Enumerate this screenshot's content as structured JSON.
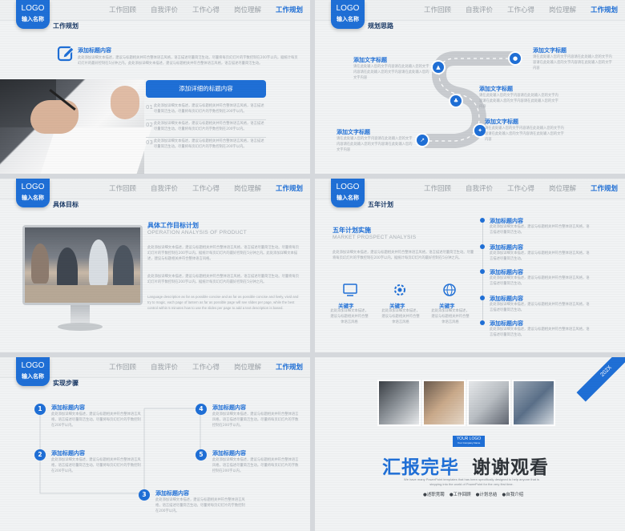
{
  "nav": [
    "工作回顾",
    "自我评价",
    "工作心得",
    "岗位理解",
    "工作规划"
  ],
  "logo": {
    "line1": "LOGO",
    "line2": "输入名称"
  },
  "slide1": {
    "title": "工作规划",
    "heading": "添加标题内容",
    "body": "此处添加详细文本描述，建议与标题相关并符合整体语言风格，语言描述尽量简洁生动。尽量将每页幻灯片的字数控制在200字以内，据统计每页幻灯片的最好控制在5分钟之内。此处添加详细文本描述，建议与标题相关并符合整体语言风格，语言描述尽量简洁生动。",
    "button": "添加详细的标题内容",
    "items": [
      {
        "n": "01",
        "t": "此处添加详细文本描述，建议与标题相关并符合整体语言风格，语言描述尽量简洁生动。尽量将每页幻灯片的字数控制在200字以内。"
      },
      {
        "n": "02",
        "t": "此处添加详细文本描述，建议与标题相关并符合整体语言风格，语言描述尽量简洁生动。尽量将每页幻灯片的字数控制在200字以内。"
      },
      {
        "n": "03",
        "t": "此处添加详细文本描述，建议与标题相关并符合整体语言风格，语言描述尽量简洁生动。尽量将每页幻灯片的字数控制在200字以内。"
      }
    ]
  },
  "slide2": {
    "title": "规划思路",
    "items": [
      {
        "h": "添加文字标题",
        "t": "请在此处输入您的文字内容请在此处输入您的文字内容请在此处输入您的文字内容请在此处输入您的文字内容"
      },
      {
        "h": "添加文字标题",
        "t": "请在此处输入您的文字内容请在此处输入您的文字内容请在此处输入您的文字内容请在此处输入您的文字内容"
      },
      {
        "h": "添加文字标题",
        "t": "请在此处输入您的文字内容请在此处输入您的文字内容请在此处输入您的文字内容请在此处输入您的文字内容"
      },
      {
        "h": "添加文字标题",
        "t": "请在此处输入您的文字内容请在此处输入您的文字内容请在此处输入您的文字内容请在此处输入您的文字内容"
      },
      {
        "h": "添加文字标题",
        "t": "请在此处输入您的文字内容请在此处输入您的文字内容请在此处输入您的文字内容请在此处输入您的文字内容"
      }
    ]
  },
  "slide3": {
    "title": "具体目标",
    "heading": "具体工作目标计划",
    "sub": "OPERATION ANALYSIS OF PRODUCT",
    "p1": "此处添加详细文本描述，建议与标题相关并符合整体语言风格，语言描述尽量简洁生动。尽量将每页幻灯片的字数控制在200字以内，据统计每页幻灯片的最好控制在5分钟之内。此处添加详细文本描述，建议与标题相关并符合整体语言风格。",
    "p2": "此处添加详细文本描述，建议与标题相关并符合整体语言风格，语言描述尽量简洁生动。尽量将每页幻灯片的字数控制在200字以内，据统计每页幻灯片的最好控制在5分钟之内。",
    "p3": "Language description as far as possible concise and as far as possible concise and lively, vivid and try to magic, each page of lantern as far as possible page will see slides per page, while the best control within 5 minutes how to use the slides per page to add a text description is based."
  },
  "slide4": {
    "title": "五年计划",
    "heading": "五年计划实施",
    "sub": "MARKET PROSPECT ANALYSIS",
    "body": "此处添加详细文本描述，建议与标题相关并符合整体语言风格，语言描述尽量简洁生动。尽量将每页幻灯片的字数控制在200字以内，据统计每页幻灯片的最好控制在5分钟之内。",
    "keys": [
      {
        "k": "关键字",
        "t": "此处添加详细文本描述，建议与标题相关并符合整体语言风格"
      },
      {
        "k": "关键字",
        "t": "此处添加详细文本描述，建议与标题相关并符合整体语言风格"
      },
      {
        "k": "关键字",
        "t": "此处添加详细文本描述，建议与标题相关并符合整体语言风格"
      }
    ],
    "timeline": [
      {
        "h": "添加标题内容",
        "t": "此处添加详细文本描述，建议与标题相关并符合整体语言风格，语言描述尽量简洁生动。"
      },
      {
        "h": "添加标题内容",
        "t": "此处添加详细文本描述，建议与标题相关并符合整体语言风格，语言描述尽量简洁生动。"
      },
      {
        "h": "添加标题内容",
        "t": "此处添加详细文本描述，建议与标题相关并符合整体语言风格，语言描述尽量简洁生动。"
      },
      {
        "h": "添加标题内容",
        "t": "此处添加详细文本描述，建议与标题相关并符合整体语言风格，语言描述尽量简洁生动。"
      },
      {
        "h": "添加标题内容",
        "t": "此处添加详细文本描述，建议与标题相关并符合整体语言风格，语言描述尽量简洁生动。"
      }
    ]
  },
  "slide5": {
    "title": "实现步骤",
    "steps": [
      {
        "n": "1",
        "h": "添加标题内容",
        "t": "此处添加详细文本描述，建议与标题相关并符合整体语言风格，语言描述尽量简洁生动。尽量将每页幻灯片的字数控制在200字以内。"
      },
      {
        "n": "2",
        "h": "添加标题内容",
        "t": "此处添加详细文本描述，建议与标题相关并符合整体语言风格，语言描述尽量简洁生动。尽量将每页幻灯片的字数控制在200字以内。"
      },
      {
        "n": "3",
        "h": "添加标题内容",
        "t": "此处添加详细文本描述，建议与标题相关并符合整体语言风格，语言描述尽量简洁生动。尽量将每页幻灯片的字数控制在200字以内。"
      },
      {
        "n": "4",
        "h": "添加标题内容",
        "t": "此处添加详细文本描述，建议与标题相关并符合整体语言风格，语言描述尽量简洁生动。尽量将每页幻灯片的字数控制在200字以内。"
      },
      {
        "n": "5",
        "h": "添加标题内容",
        "t": "此处添加详细文本描述，建议与标题相关并符合整体语言风格，语言描述尽量简洁生动。尽量将每页幻灯片的字数控制在200字以内。"
      }
    ]
  },
  "slide6": {
    "ribbon": "202X",
    "logo": "YOUR LOGO",
    "logo_sub": "Your Company Name",
    "title_a": "汇报完毕",
    "title_b": "谢谢观看",
    "en": "We have many PowerPoint templates that has been specifically designed to help anyone that is stepping into the world of PowerPoint for the very first time.",
    "tags": [
      "●述职竞聘",
      "●工作回顾",
      "●计划总结",
      "●自我介绍"
    ]
  },
  "colors": {
    "accent": "#1f6fd6",
    "dark": "#1b3a66"
  }
}
